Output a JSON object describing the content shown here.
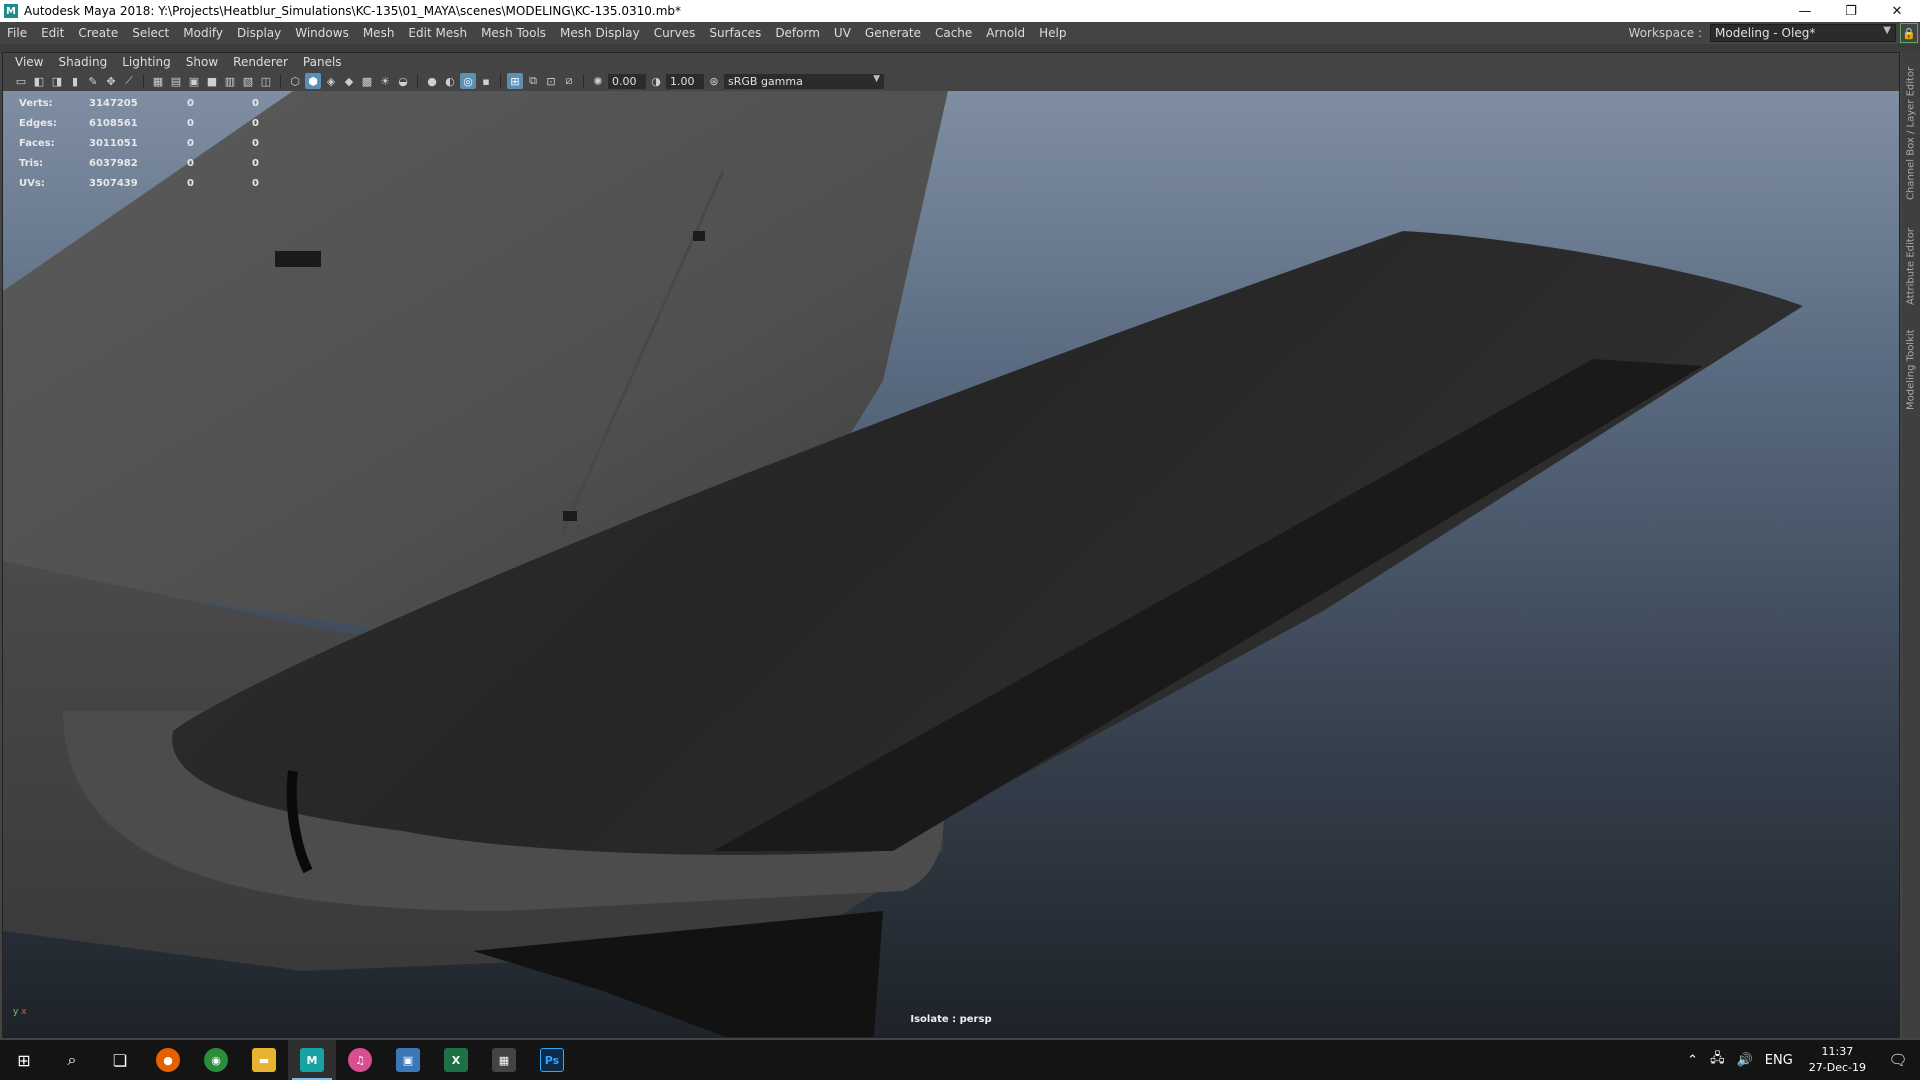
{
  "window": {
    "title": "Autodesk Maya 2018: Y:\\Projects\\Heatblur_Simulations\\KC-135\\01_MAYA\\scenes\\MODELING\\KC-135.0310.mb*",
    "minimize": "—",
    "restore": "❐",
    "close": "✕"
  },
  "menubar": {
    "items": [
      "File",
      "Edit",
      "Create",
      "Select",
      "Modify",
      "Display",
      "Windows",
      "Mesh",
      "Edit Mesh",
      "Mesh Tools",
      "Mesh Display",
      "Curves",
      "Surfaces",
      "Deform",
      "UV",
      "Generate",
      "Cache",
      "Arnold",
      "Help"
    ],
    "workspace_label": "Workspace :",
    "workspace_value": "Modeling - Oleg*"
  },
  "panel": {
    "menu": [
      "View",
      "Shading",
      "Lighting",
      "Show",
      "Renderer",
      "Panels"
    ],
    "toolbar": {
      "exposure": "0.00",
      "gamma": "1.00",
      "color_space": "sRGB gamma"
    }
  },
  "hud": {
    "rows": [
      {
        "label": "Verts:",
        "value": "3147205",
        "selected": "0",
        "bound": "0"
      },
      {
        "label": "Edges:",
        "value": "6108561",
        "selected": "0",
        "bound": "0"
      },
      {
        "label": "Faces:",
        "value": "3011051",
        "selected": "0",
        "bound": "0"
      },
      {
        "label": "Tris:",
        "value": "6037982",
        "selected": "0",
        "bound": "0"
      },
      {
        "label": "UVs:",
        "value": "3507439",
        "selected": "0",
        "bound": "0"
      }
    ],
    "isolate": "Isolate : persp",
    "axis_y": "y",
    "axis_x": "x"
  },
  "sidedock": {
    "tabs": [
      "Channel Box / Layer Editor",
      "Attribute Editor",
      "Modeling Toolkit"
    ]
  },
  "taskbar": {
    "apps": [
      {
        "name": "firefox",
        "color": "#e66000",
        "glyph": "●"
      },
      {
        "name": "chrome",
        "color": "#2a8d3c",
        "glyph": "◉"
      },
      {
        "name": "explorer",
        "color": "#e8b330",
        "glyph": "▬"
      },
      {
        "name": "maya",
        "color": "#17a3a3",
        "glyph": "M"
      },
      {
        "name": "itunes",
        "color": "#d94e8f",
        "glyph": "♫"
      },
      {
        "name": "photos",
        "color": "#3b78b8",
        "glyph": "▣"
      },
      {
        "name": "excel",
        "color": "#1e7145",
        "glyph": "X"
      },
      {
        "name": "calculator",
        "color": "#444444",
        "glyph": "▦"
      },
      {
        "name": "photoshop",
        "color": "#0a2a45",
        "glyph": "Ps"
      }
    ],
    "language": "ENG",
    "time": "11:37",
    "date": "27-Dec-19"
  }
}
